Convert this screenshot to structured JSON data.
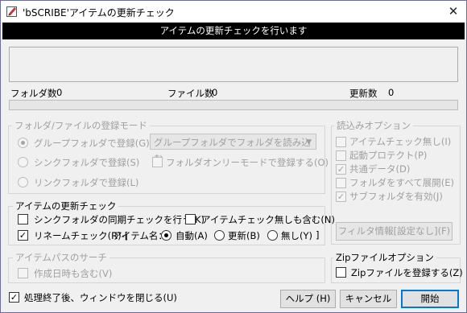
{
  "window": {
    "title": "'bSCRIBE'アイテムの更新チェック",
    "close_glyph": "✕"
  },
  "banner": {
    "text": "アイテムの更新チェックを行います"
  },
  "counts": {
    "folders_label": "フォルダ数",
    "folders_value": "0",
    "files_label": "ファイル数",
    "files_value": "0",
    "updates_label": "更新数",
    "updates_value": "0"
  },
  "register_mode": {
    "legend": "フォルダ/ファイルの登録モード",
    "radio_group": "グループフォルダで登録(G)",
    "radio_sync": "シンクフォルダで登録(S)",
    "radio_link": "リンクフォルダで登録(L)",
    "select_value": "グループフォルダでフォルダを読み込む",
    "folder_only": "フォルダオンリーモードで登録する(O)"
  },
  "read_options": {
    "legend": "読込みオプション",
    "items": [
      {
        "label": "アイテムチェック無し(I)",
        "checked": false
      },
      {
        "label": "起動プロテクト(P)",
        "checked": false
      },
      {
        "label": "共通データ(D)",
        "checked": true
      },
      {
        "label": "フォルダをすべて展開(E)",
        "checked": false
      },
      {
        "label": "サブフォルダを有効(J)",
        "checked": true
      }
    ],
    "filter_button": "フィルタ情報[設定なし](F)"
  },
  "update_check": {
    "legend": "アイテムの更新チェック",
    "sync_check": "シンクフォルダの同期チェックを行う(K)",
    "no_item_check": "アイテムチェック無しも含む(N)",
    "rename_check": "リネームチェック(R)-[",
    "item_name_label": "アイテム名：",
    "opt_auto": "自動(A)",
    "opt_update": "更新(B)",
    "opt_none": "無し(Y)",
    "close_bracket": "]"
  },
  "path_search": {
    "legend": "アイテムパスのサーチ",
    "include_date": "作成日時も含む(V)"
  },
  "zip": {
    "legend": "Zipファイルオプション",
    "register_zip": "Zipファイルを登録する(Z)"
  },
  "footer": {
    "close_after": "処理終了後、ウィンドウを閉じる(U)",
    "help": "ヘルプ (H)",
    "cancel": "キャンセル",
    "start": "開始"
  },
  "icons": {
    "app": "app-pencil-icon",
    "checkmark": "✓"
  },
  "colors": {
    "banner_bg": "#000000",
    "default_button": "#0078d7",
    "app_icon": "#c8303a"
  }
}
